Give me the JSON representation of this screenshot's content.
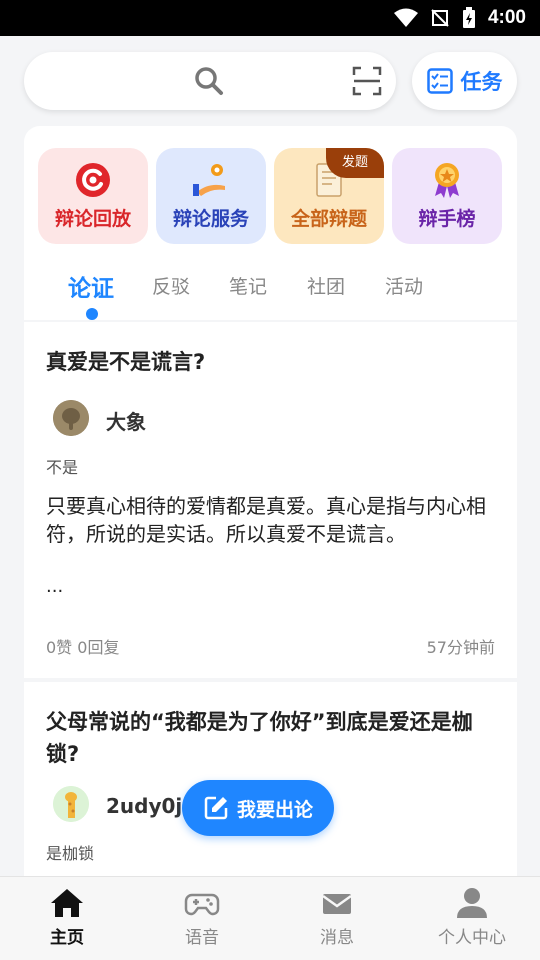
{
  "status_bar": {
    "time": "4:00"
  },
  "header": {
    "search": {
      "placeholder": ""
    },
    "task_button": {
      "label": "任务"
    }
  },
  "quick_tiles": [
    {
      "label": "辩论回放",
      "icon": "replay-icon",
      "color": "#d9262a",
      "bg": "#fde6e6"
    },
    {
      "label": "辩论服务",
      "icon": "service-icon",
      "color": "#2a43b8",
      "bg": "#dfe8fd"
    },
    {
      "label": "全部辩题",
      "icon": "topics-icon",
      "color": "#c8641a",
      "bg": "#fde7bf",
      "badge": "发题"
    },
    {
      "label": "辩手榜",
      "icon": "ranking-icon",
      "color": "#6a24a8",
      "bg": "#f0e4fb"
    }
  ],
  "tabs": [
    {
      "label": "论证",
      "active": true
    },
    {
      "label": "反驳",
      "active": false
    },
    {
      "label": "笔记",
      "active": false
    },
    {
      "label": "社团",
      "active": false
    },
    {
      "label": "活动",
      "active": false
    }
  ],
  "posts": [
    {
      "title": "真爱是不是谎言?",
      "author": "大象",
      "stance": "不是",
      "body": "只要真心相待的爱情都是真爱。真心是指与内心相符，所说的是实话。所以真爱不是谎言。",
      "ellipsis": "...",
      "stats": "0赞 0回复",
      "time": "57分钟前"
    },
    {
      "title": "父母常说的“我都是为了你好”到底是爱还是枷锁?",
      "author": "2udy0jnt",
      "stance": "是枷锁"
    }
  ],
  "fab": {
    "label": "我要出论"
  },
  "bottom_nav": [
    {
      "label": "主页",
      "icon": "home-icon",
      "active": true
    },
    {
      "label": "语音",
      "icon": "gamepad-icon",
      "active": false
    },
    {
      "label": "消息",
      "icon": "mail-icon",
      "active": false
    },
    {
      "label": "个人中心",
      "icon": "person-icon",
      "active": false
    }
  ],
  "colors": {
    "accent": "#1f86ff",
    "task_blue": "#1f7aff"
  }
}
